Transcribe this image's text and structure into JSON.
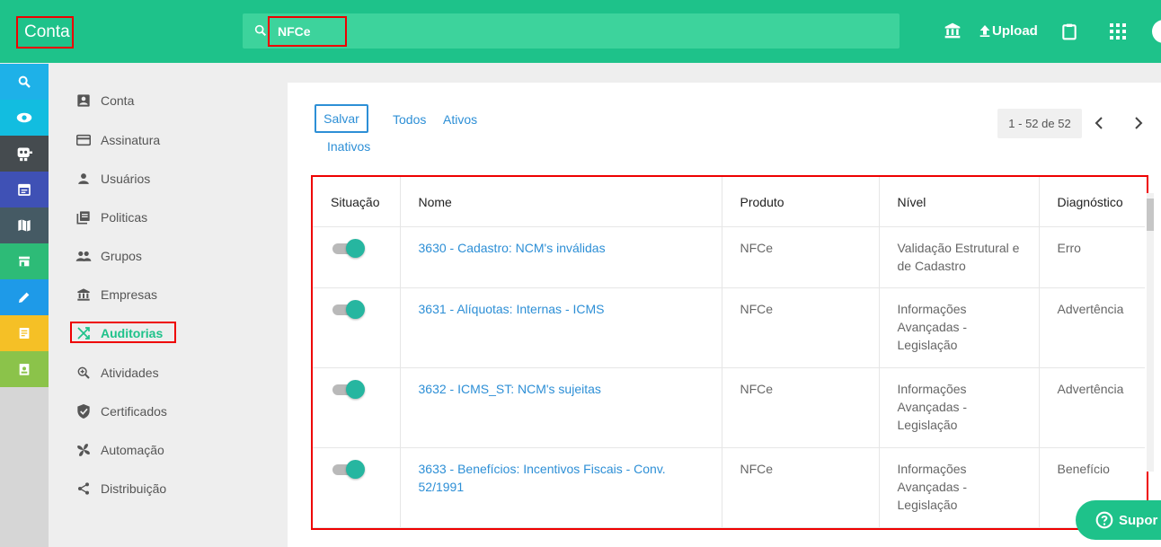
{
  "header": {
    "app_title": "Conta",
    "search_value": "NFCe",
    "upload_label": "Upload"
  },
  "rail": [
    {
      "icon": "zoom-icon",
      "color": "#1eb1e8"
    },
    {
      "icon": "eye-icon",
      "color": "#12bde0"
    },
    {
      "icon": "robot-icon",
      "color": "#454b4f"
    },
    {
      "icon": "calendar-icon",
      "color": "#3f51b5"
    },
    {
      "icon": "map-icon",
      "color": "#455a64"
    },
    {
      "icon": "store-icon",
      "color": "#2dbb77"
    },
    {
      "icon": "pencil-icon",
      "color": "#1e9ae8"
    },
    {
      "icon": "receipt-icon",
      "color": "#f5c026"
    },
    {
      "icon": "badge-icon",
      "color": "#8bc34a"
    }
  ],
  "nav": [
    {
      "label": "Conta",
      "icon": "account-box-icon"
    },
    {
      "label": "Assinatura",
      "icon": "credit-card-icon"
    },
    {
      "label": "Usuários",
      "icon": "person-icon"
    },
    {
      "label": "Politicas",
      "icon": "library-books-icon"
    },
    {
      "label": "Grupos",
      "icon": "group-icon"
    },
    {
      "label": "Empresas",
      "icon": "bank-icon"
    },
    {
      "label": "Auditorias",
      "icon": "shuffle-icon",
      "active": true
    },
    {
      "label": "Atividades",
      "icon": "zoom-in-icon"
    },
    {
      "label": "Certificados",
      "icon": "shield-check-icon"
    },
    {
      "label": "Automação",
      "icon": "fan-icon"
    },
    {
      "label": "Distribuição",
      "icon": "share-icon"
    }
  ],
  "toolbar": {
    "save_label": "Salvar",
    "filter_all": "Todos",
    "filter_active": "Ativos",
    "filter_inactive": "Inativos",
    "pagination": "1 - 52 de 52"
  },
  "table": {
    "headers": [
      "Situação",
      "Nome",
      "Produto",
      "Nível",
      "Diagnóstico"
    ],
    "rows": [
      {
        "name": "3630 - Cadastro: NCM's inválidas",
        "product": "NFCe",
        "level": "Validação Estrutural e de Cadastro",
        "diagnosis": "Erro",
        "active": true
      },
      {
        "name": "3631 - Alíquotas: Internas - ICMS",
        "product": "NFCe",
        "level": "Informações Avançadas - Legislação",
        "diagnosis": "Advertência",
        "active": true
      },
      {
        "name": "3632 - ICMS_ST: NCM's sujeitas",
        "product": "NFCe",
        "level": "Informações Avançadas - Legislação",
        "diagnosis": "Advertência",
        "active": true
      },
      {
        "name": "3633 - Benefícios: Incentivos Fiscais - Conv. 52/1991",
        "product": "NFCe",
        "level": "Informações Avançadas - Legislação",
        "diagnosis": "Benefício",
        "active": true
      }
    ]
  },
  "support_label": "Supor",
  "colors": {
    "primary": "#1ec28a",
    "link": "#2d8fd6",
    "toggle": "#26b6a0"
  }
}
